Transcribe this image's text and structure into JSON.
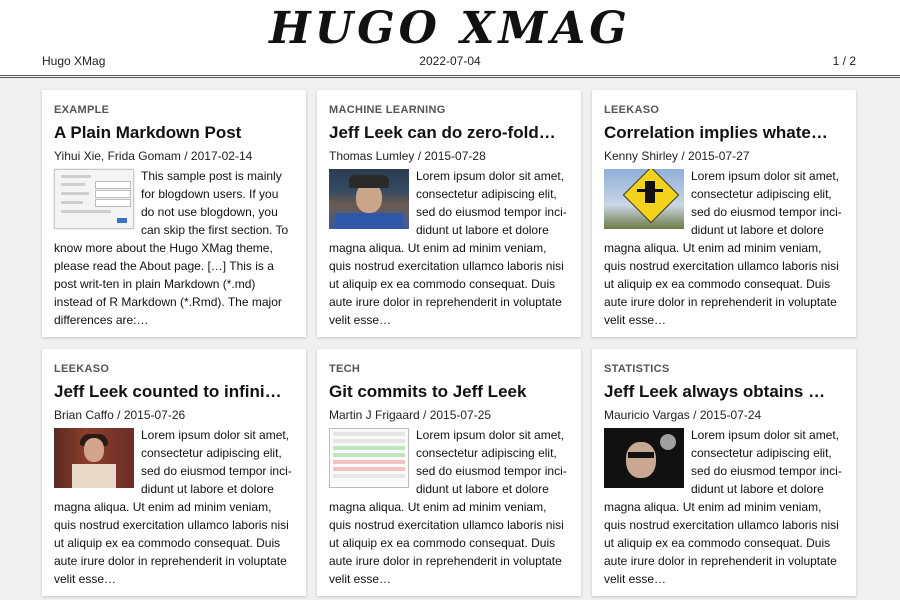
{
  "site": {
    "logo": "HUGO XMAG",
    "name": "Hugo XMag",
    "date": "2022-07-04",
    "page_indicator": "1 / 2"
  },
  "posts": [
    {
      "category": "EXAMPLE",
      "title": "A Plain Markdown Post",
      "meta": "Yihui Xie, Frida Gomam / 2017-02-14",
      "thumbnail": "form-screenshot",
      "excerpt": "This sample post is mainly for blogdown users. If you do not use blogdown, you can skip the first section. To know more about the Hugo XMag theme, please read the About page. […] This is a post writ-ten in plain Markdown (*.md) instead of R Markdown (*.Rmd). The major differences are:…"
    },
    {
      "category": "MACHINE LEARNING",
      "title": "Jeff Leek can do zero-fold…",
      "meta": "Thomas Lumley / 2015-07-28",
      "thumbnail": "man-with-hat-photo",
      "excerpt": "Lorem ipsum dolor sit amet, consectetur adipiscing elit, sed do eiusmod tempor inci-didunt ut labore et dolore magna aliqua. Ut enim ad minim veniam, quis nostrud exercitation ullamco laboris nisi ut aliquip ex ea commodo consequat. Duis aute irure dolor in reprehenderit in voluptate velit esse…"
    },
    {
      "category": "LEEKASO",
      "title": "Correlation implies whate…",
      "meta": "Kenny Shirley / 2015-07-27",
      "thumbnail": "you-shall-not-pass-sign",
      "excerpt": "Lorem ipsum dolor sit amet, consectetur adipiscing elit, sed do eiusmod tempor inci-didunt ut labore et dolore magna aliqua. Ut enim ad minim veniam, quis nostrud exercitation ullamco laboris nisi ut aliquip ex ea commodo consequat. Duis aute irure dolor in reprehenderit in voluptate velit esse…"
    },
    {
      "category": "LEEKASO",
      "title": "Jeff Leek counted to infini…",
      "meta": "Brian Caffo / 2015-07-26",
      "thumbnail": "woman-in-hallway-photo",
      "excerpt": "Lorem ipsum dolor sit amet, consectetur adipiscing elit, sed do eiusmod tempor inci-didunt ut labore et dolore magna aliqua. Ut enim ad minim veniam, quis nostrud exercitation ullamco laboris nisi ut aliquip ex ea commodo consequat. Duis aute irure dolor in reprehenderit in voluptate velit esse…"
    },
    {
      "category": "TECH",
      "title": "Git commits to Jeff Leek",
      "meta": "Martin J Frigaard / 2015-07-25",
      "thumbnail": "git-diff-screenshot",
      "excerpt": "Lorem ipsum dolor sit amet, consectetur adipiscing elit, sed do eiusmod tempor inci-didunt ut labore et dolore magna aliqua. Ut enim ad minim veniam, quis nostrud exercitation ullamco laboris nisi ut aliquip ex ea commodo consequat. Duis aute irure dolor in reprehenderit in voluptate velit esse…"
    },
    {
      "category": "STATISTICS",
      "title": "Jeff Leek always obtains …",
      "meta": "Mauricio Vargas / 2015-07-24",
      "thumbnail": "man-with-sunglasses-photo",
      "excerpt": "Lorem ipsum dolor sit amet, consectetur adipiscing elit, sed do eiusmod tempor inci-didunt ut labore et dolore magna aliqua. Ut enim ad minim veniam, quis nostrud exercitation ullamco laboris nisi ut aliquip ex ea commodo consequat. Duis aute irure dolor in reprehenderit in voluptate velit esse…"
    }
  ]
}
